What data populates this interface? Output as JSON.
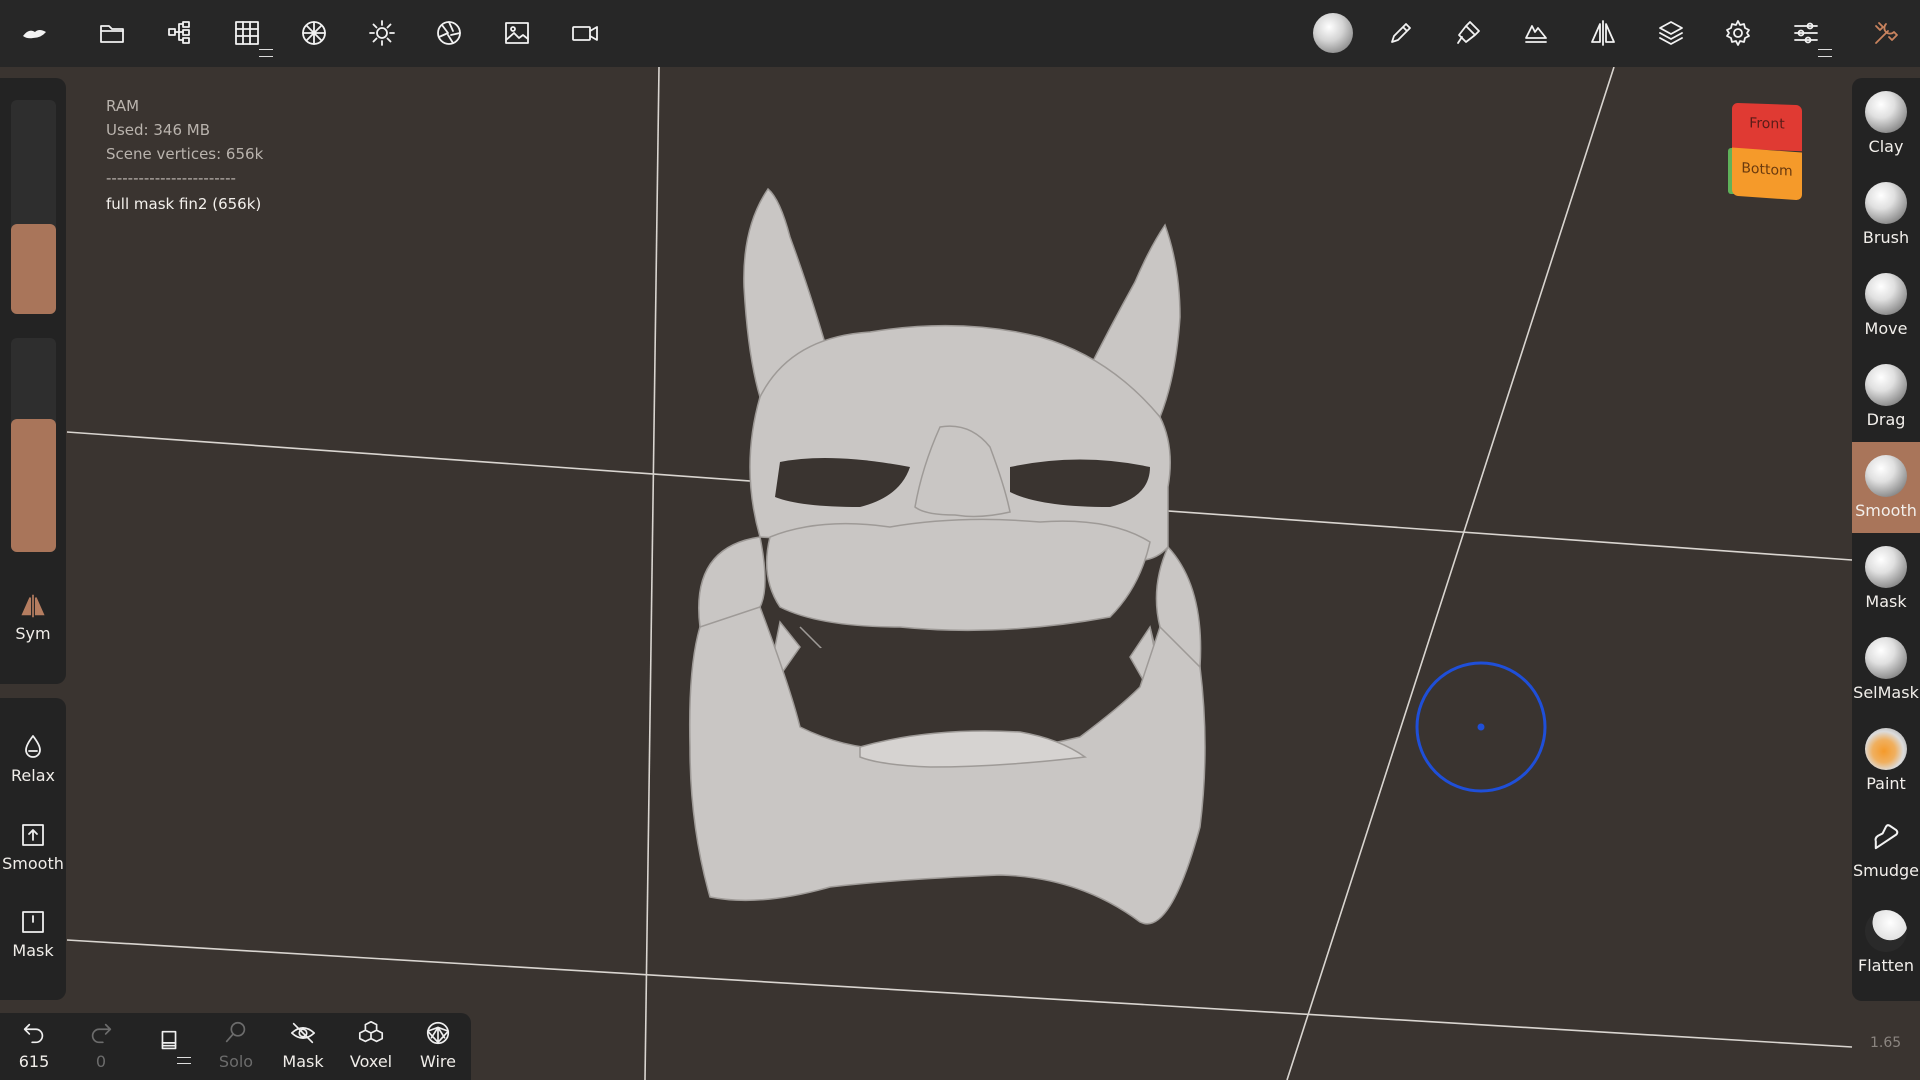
{
  "topbar": {
    "left_icons": [
      "app-logo-icon",
      "folder-icon",
      "scene-tree-icon",
      "grid-icon",
      "topology-icon",
      "light-icon",
      "material-icon",
      "background-image-icon",
      "camera-icon"
    ],
    "right_icons": [
      "brush-preview-icon",
      "stroke-icon",
      "paint-tool-icon",
      "texture-icon",
      "symmetry-icon",
      "layers-icon",
      "settings-icon",
      "sliders-icon",
      "tools-icon"
    ]
  },
  "info": {
    "ram": "RAM",
    "used": "Used: 346 MB",
    "vertices": "Scene vertices: 656k",
    "separator": "------------------------",
    "object_name": "full mask fin2 (656k)"
  },
  "left_panel": {
    "slider_top_level": 0.42,
    "slider_bottom_level": 0.62,
    "sym_label": "Sym",
    "buttons": [
      {
        "label": "Relax",
        "icon": "drop-icon"
      },
      {
        "label": "Smooth",
        "icon": "upload-square-icon"
      },
      {
        "label": "Mask",
        "icon": "mask-square-icon"
      }
    ]
  },
  "bottom_bar": {
    "undo_count": "615",
    "redo_count": "0",
    "items": [
      {
        "label": "Solo",
        "icon": "search-icon",
        "enabled": false
      },
      {
        "label": "Mask",
        "icon": "eye-slash-icon",
        "enabled": true
      },
      {
        "label": "Voxel",
        "icon": "voxel-icon",
        "enabled": true
      },
      {
        "label": "Wire",
        "icon": "wireframe-icon",
        "enabled": true
      }
    ]
  },
  "tools": [
    {
      "label": "Clay",
      "active": false
    },
    {
      "label": "Brush",
      "active": false
    },
    {
      "label": "Move",
      "active": false
    },
    {
      "label": "Drag",
      "active": false
    },
    {
      "label": "Smooth",
      "active": true
    },
    {
      "label": "Mask",
      "active": false
    },
    {
      "label": "SelMask",
      "active": false
    },
    {
      "label": "Paint",
      "active": false
    },
    {
      "label": "Smudge",
      "active": false
    },
    {
      "label": "Flatten",
      "active": false
    }
  ],
  "view_cube": {
    "front": "Front",
    "bottom": "Bottom"
  },
  "zoom": "1.65",
  "colors": {
    "accent": "#a9755a",
    "panel": "#232323",
    "viewport": "#3a3430",
    "cursor": "#1f4fd8"
  }
}
